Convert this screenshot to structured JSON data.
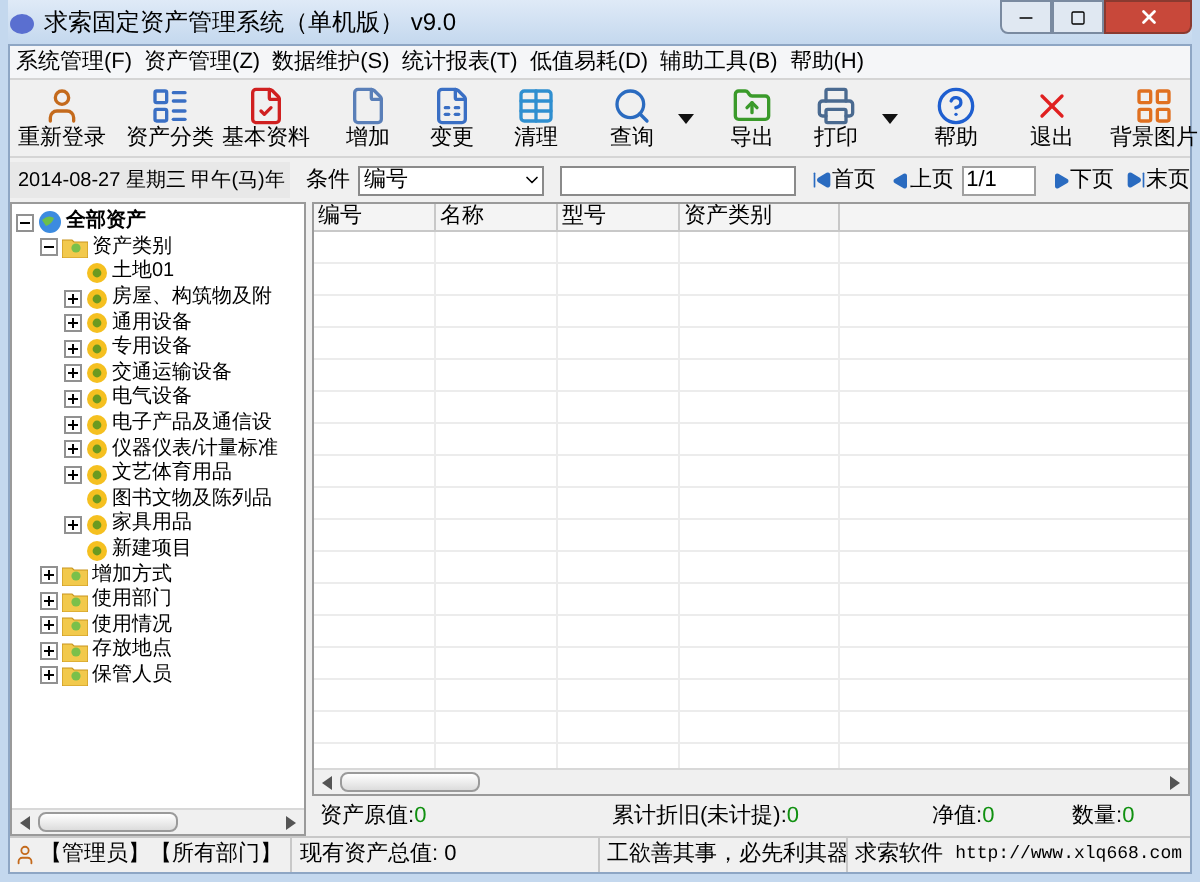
{
  "window": {
    "title": "求索固定资产管理系统（单机版） v9.0"
  },
  "menu": [
    "系统管理(F)",
    "资产管理(Z)",
    "数据维护(S)",
    "统计报表(T)",
    "低值易耗(D)",
    "辅助工具(B)",
    "帮助(H)"
  ],
  "toolbar": [
    [
      {
        "label": "重新登录",
        "dropdown": false
      }
    ],
    [
      {
        "label": "资产分类",
        "dropdown": false
      },
      {
        "label": "基本资料",
        "dropdown": false
      }
    ],
    [
      {
        "label": "增加",
        "dropdown": false
      },
      {
        "label": "变更",
        "dropdown": false
      },
      {
        "label": "清理",
        "dropdown": false
      }
    ],
    [
      {
        "label": "查询",
        "dropdown": true
      }
    ],
    [
      {
        "label": "导出",
        "dropdown": false
      },
      {
        "label": "打印",
        "dropdown": true
      }
    ],
    [
      {
        "label": "帮助",
        "dropdown": false
      }
    ],
    [
      {
        "label": "退出",
        "dropdown": false
      }
    ],
    [
      {
        "label": "背景图片",
        "dropdown": false
      }
    ]
  ],
  "filter": {
    "date": "2014-08-27 星期三 甲午(马)年",
    "condition_label": "条件",
    "condition": "编号",
    "first": "首页",
    "prev": "上页",
    "page": "1/1",
    "next": "下页",
    "last": "末页"
  },
  "tree": [
    {
      "label": "全部资产",
      "kind": "root",
      "expanded": true,
      "children": [
        {
          "label": "资产类别",
          "kind": "group",
          "expanded": true,
          "children": [
            {
              "label": "土地01",
              "kind": "item"
            },
            {
              "label": "房屋、构筑物及附",
              "kind": "item",
              "expanded": false
            },
            {
              "label": "通用设备",
              "kind": "item",
              "expanded": false
            },
            {
              "label": "专用设备",
              "kind": "item",
              "expanded": false
            },
            {
              "label": "交通运输设备",
              "kind": "item",
              "expanded": false
            },
            {
              "label": "电气设备",
              "kind": "item",
              "expanded": false
            },
            {
              "label": "电子产品及通信设",
              "kind": "item",
              "expanded": false
            },
            {
              "label": "仪器仪表/计量标准",
              "kind": "item",
              "expanded": false
            },
            {
              "label": "文艺体育用品",
              "kind": "item",
              "expanded": false
            },
            {
              "label": "图书文物及陈列品",
              "kind": "item"
            },
            {
              "label": "家具用品",
              "kind": "item",
              "expanded": false
            },
            {
              "label": "新建项目",
              "kind": "item"
            }
          ]
        },
        {
          "label": "增加方式",
          "kind": "group",
          "expanded": false
        },
        {
          "label": "使用部门",
          "kind": "group",
          "expanded": false
        },
        {
          "label": "使用情况",
          "kind": "group",
          "expanded": false
        },
        {
          "label": "存放地点",
          "kind": "group",
          "expanded": false
        },
        {
          "label": "保管人员",
          "kind": "group",
          "expanded": false
        }
      ]
    }
  ],
  "table": {
    "columns": [
      "编号",
      "名称",
      "型号",
      "资产类别"
    ]
  },
  "summary": [
    {
      "label": "资产原值:",
      "value": "0"
    },
    {
      "label": "累计折旧(未计提):",
      "value": "0"
    },
    {
      "label": "净值:",
      "value": "0"
    },
    {
      "label": "数量:",
      "value": "0"
    }
  ],
  "status_bar": {
    "user": "【管理员】【所有部门】",
    "total": "现有资产总值: 0",
    "motto": "工欲善其事，必先利其器",
    "company": "求索软件",
    "url": "http://www.xlq668.com"
  }
}
